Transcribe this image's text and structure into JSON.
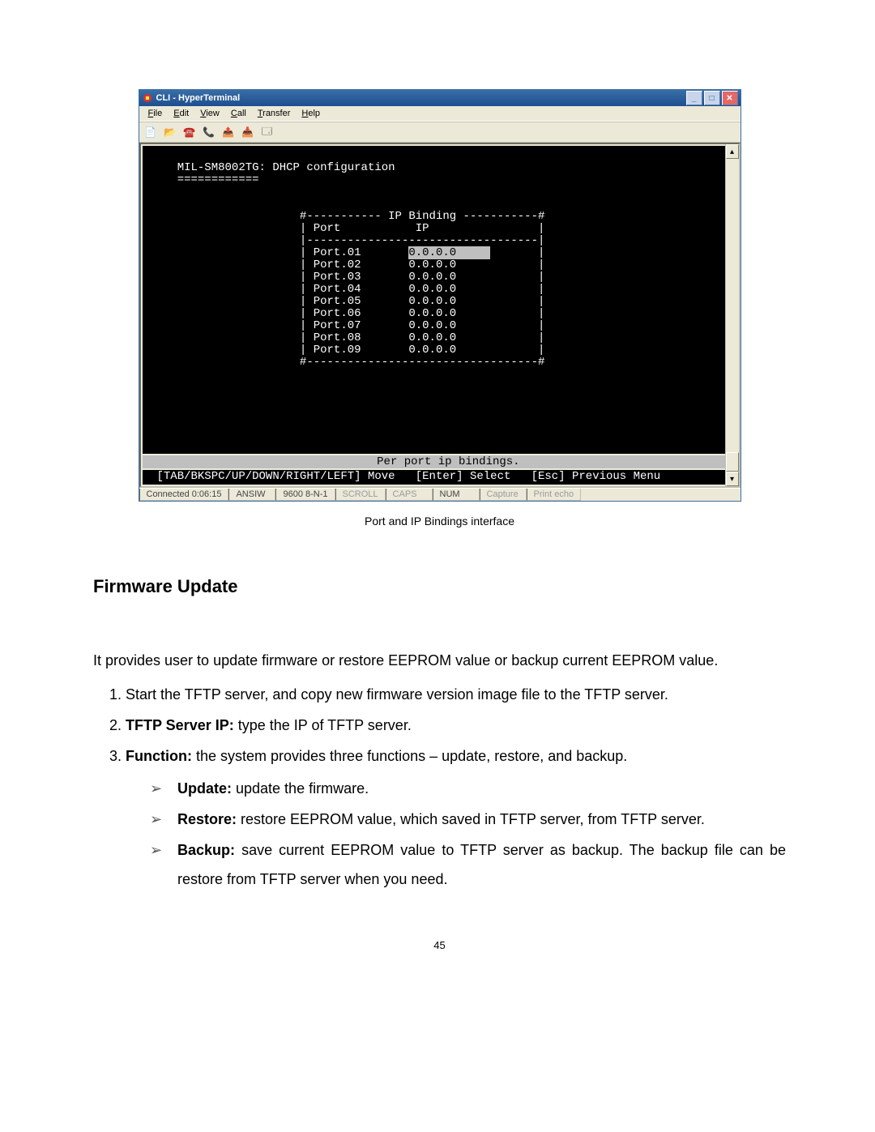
{
  "window": {
    "title": "CLI - HyperTerminal",
    "menu": {
      "file": "File",
      "edit": "Edit",
      "view": "View",
      "call": "Call",
      "transfer": "Transfer",
      "help": "Help"
    }
  },
  "terminal": {
    "prompt_line": "MIL-SM8002TG: DHCP configuration",
    "divider": "============",
    "box_title": "IP Binding",
    "col_port": "Port",
    "col_ip": "IP",
    "rows": [
      {
        "port": "Port.01",
        "ip": "0.0.0.0",
        "sel": true
      },
      {
        "port": "Port.02",
        "ip": "0.0.0.0",
        "sel": false
      },
      {
        "port": "Port.03",
        "ip": "0.0.0.0",
        "sel": false
      },
      {
        "port": "Port.04",
        "ip": "0.0.0.0",
        "sel": false
      },
      {
        "port": "Port.05",
        "ip": "0.0.0.0",
        "sel": false
      },
      {
        "port": "Port.06",
        "ip": "0.0.0.0",
        "sel": false
      },
      {
        "port": "Port.07",
        "ip": "0.0.0.0",
        "sel": false
      },
      {
        "port": "Port.08",
        "ip": "0.0.0.0",
        "sel": false
      },
      {
        "port": "Port.09",
        "ip": "0.0.0.0",
        "sel": false
      }
    ],
    "status_line": "Per port ip bindings.",
    "nav_line": "[TAB/BKSPC/UP/DOWN/RIGHT/LEFT] Move   [Enter] Select   [Esc] Previous Menu"
  },
  "statusbar": {
    "conn": "Connected 0:06:15",
    "emu": "ANSIW",
    "baud": "9600 8-N-1",
    "scroll": "SCROLL",
    "caps": "CAPS",
    "num": "NUM",
    "capture": "Capture",
    "echo": "Print echo"
  },
  "doc": {
    "caption": "Port and IP Bindings interface",
    "section_title": "Firmware Update",
    "intro": "It provides user to update firmware or restore EEPROM value or backup current EEPROM value.",
    "li1": "Start the TFTP server, and copy new firmware version image file to the TFTP server.",
    "li2_b": "TFTP Server IP:",
    "li2_r": " type the IP of TFTP server.",
    "li3_b": "Function:",
    "li3_r": " the system provides three functions – update, restore, and backup.",
    "sub_update_b": "Update:",
    "sub_update_r": " update the firmware.",
    "sub_restore_b": "Restore:",
    "sub_restore_r": " restore EEPROM value, which saved in TFTP server, from TFTP server.",
    "sub_backup_b": "Backup:",
    "sub_backup_r": " save current EEPROM value to TFTP server as backup. The backup file can be restore from TFTP server when you need.",
    "page_number": "45"
  }
}
